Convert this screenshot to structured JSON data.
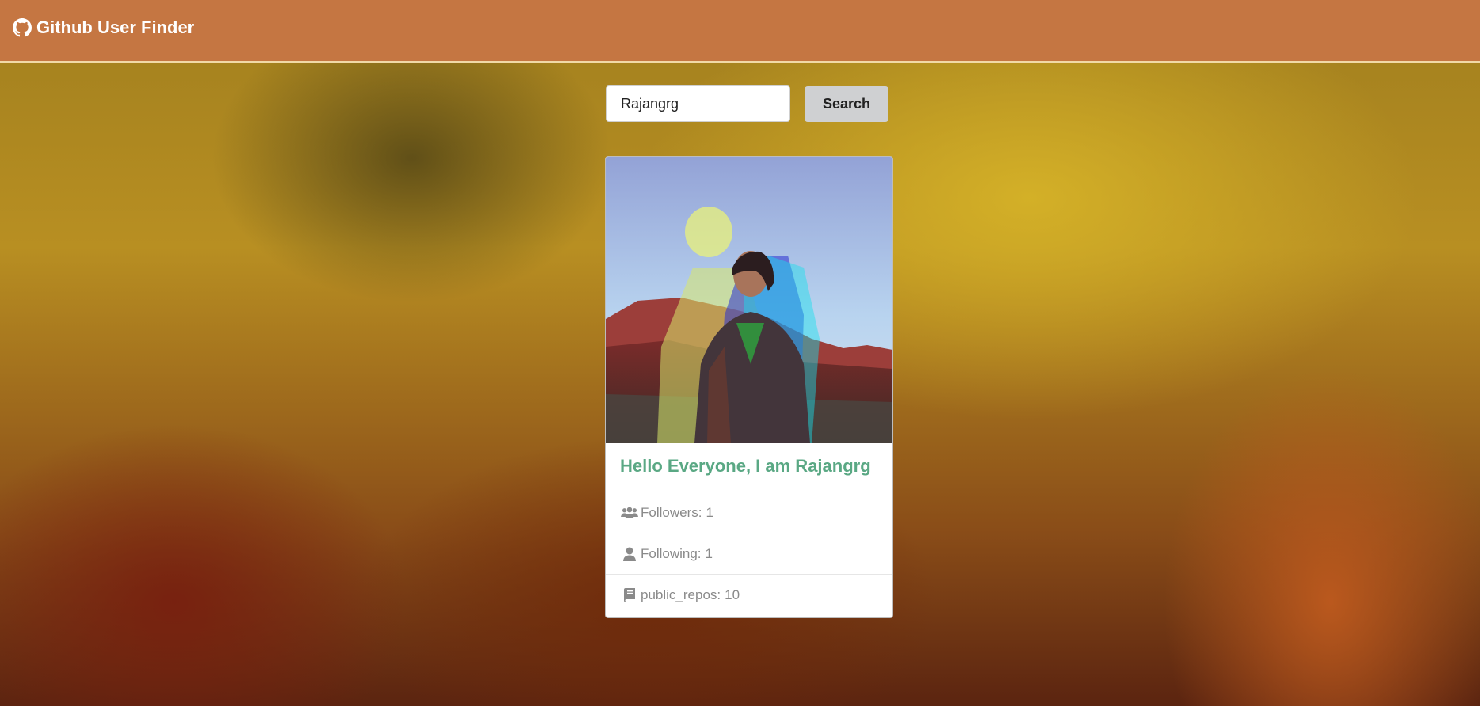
{
  "navbar": {
    "brand_icon": "github-icon",
    "brand_label": "Github User Finder"
  },
  "search": {
    "value": "Rajangrg",
    "button_label": "Search"
  },
  "profile": {
    "avatar_alt": "avatar",
    "greeting": "Hello Everyone, I am Rajangrg",
    "stats": [
      {
        "icon": "users-icon",
        "label": "Followers:",
        "value": "1"
      },
      {
        "icon": "user-icon",
        "label": "Following:",
        "value": "1"
      },
      {
        "icon": "book-icon",
        "label": "public_repos:",
        "value": "10"
      }
    ]
  },
  "colors": {
    "navbar": "#c57642",
    "greeting": "#5aa884",
    "button": "#cfd0d2"
  }
}
